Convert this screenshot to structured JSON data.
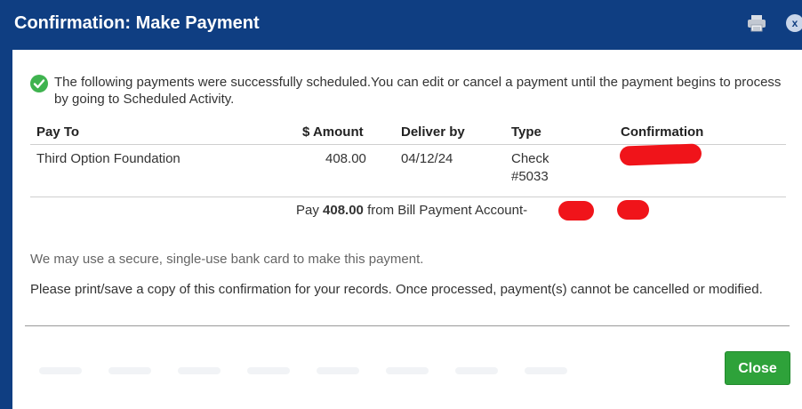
{
  "dialog": {
    "title": "Confirmation: Make Payment",
    "close_icon_label": "x",
    "icons": [
      "printer-icon",
      "close-icon",
      "success-check-icon"
    ],
    "colors": {
      "titlebar": "#0f3e82",
      "success": "#3fb34f",
      "close_button": "#2ea23a",
      "redaction": "#f0141a"
    }
  },
  "message": {
    "success": "The following payments were successfully scheduled.You can edit or cancel a payment until the payment begins to process by going to Scheduled Activity."
  },
  "table": {
    "headers": {
      "pay_to": "Pay To",
      "amount": "$ Amount",
      "deliver_by": "Deliver by",
      "type": "Type",
      "confirmation": "Confirmation"
    },
    "rows": [
      {
        "pay_to": "Third Option Foundation",
        "amount": "408.00",
        "deliver_by": "04/12/24",
        "type_line1": "Check",
        "type_line2": "#5033",
        "confirmation": ""
      }
    ]
  },
  "summary": {
    "prefix": "Pay ",
    "amount": "408.00",
    "middle": " from Bill Payment Account-",
    "separator": ", ..."
  },
  "notes": {
    "card_notice": "We may use a secure, single-use bank card to make this payment.",
    "print_notice": "Please print/save a copy of this confirmation for your records. Once processed, payment(s) cannot be cancelled or modified."
  },
  "buttons": {
    "close": "Close"
  }
}
